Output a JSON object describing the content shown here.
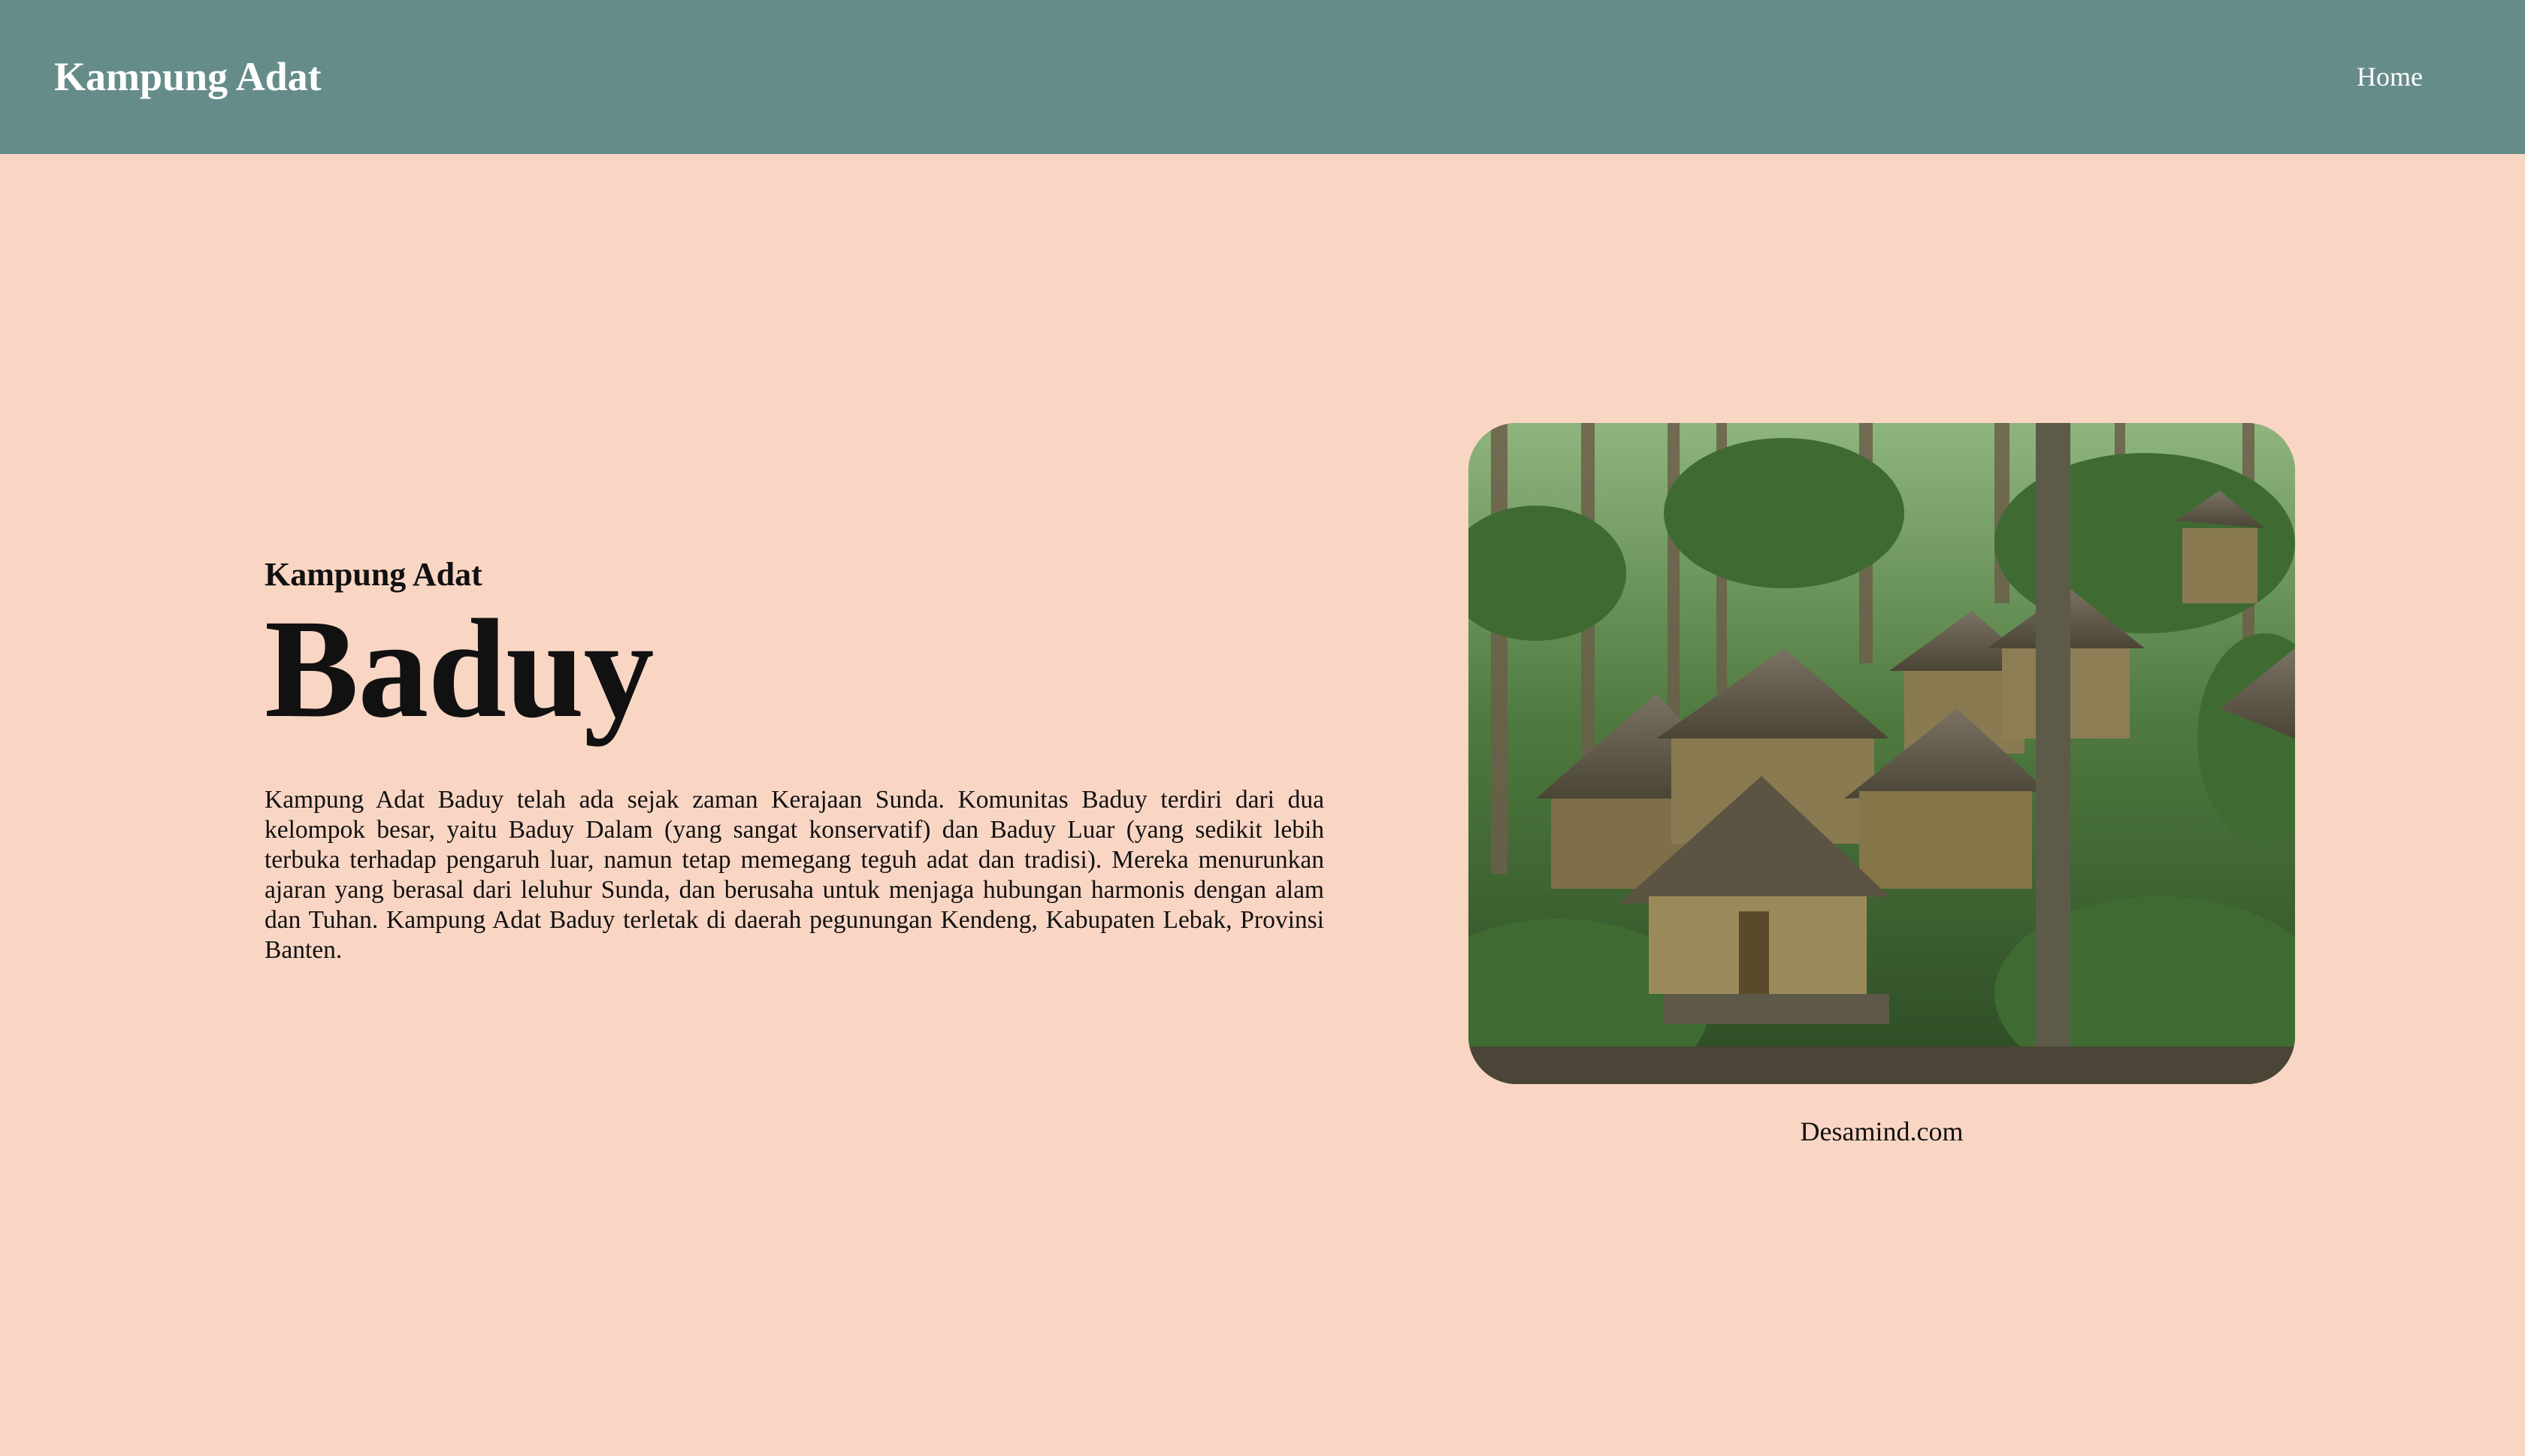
{
  "navbar": {
    "brand": "Kampung Adat",
    "links": [
      {
        "label": "Home"
      }
    ]
  },
  "hero": {
    "subtitle": "Kampung Adat",
    "title": "Baduy",
    "description": "Kampung Adat Baduy telah ada sejak zaman Kerajaan Sunda. Komunitas Baduy terdiri dari dua kelompok besar, yaitu Baduy Dalam (yang sangat konservatif) dan Baduy Luar (yang sedikit lebih terbuka terhadap pengaruh luar, namun tetap memegang teguh adat dan tradisi). Mereka menurunkan ajaran yang berasal dari leluhur Sunda, dan berusaha untuk menjaga hubungan harmonis dengan alam dan Tuhan. Kampung Adat Baduy terletak di daerah pegunungan Kendeng, Kabupaten Lebak, Provinsi Banten."
  },
  "photo": {
    "caption": "Desamind.com"
  },
  "colors": {
    "navbar": "#668c8a",
    "background": "#f9d6c4",
    "nav_text": "#ffffff",
    "body_text": "#111111"
  }
}
